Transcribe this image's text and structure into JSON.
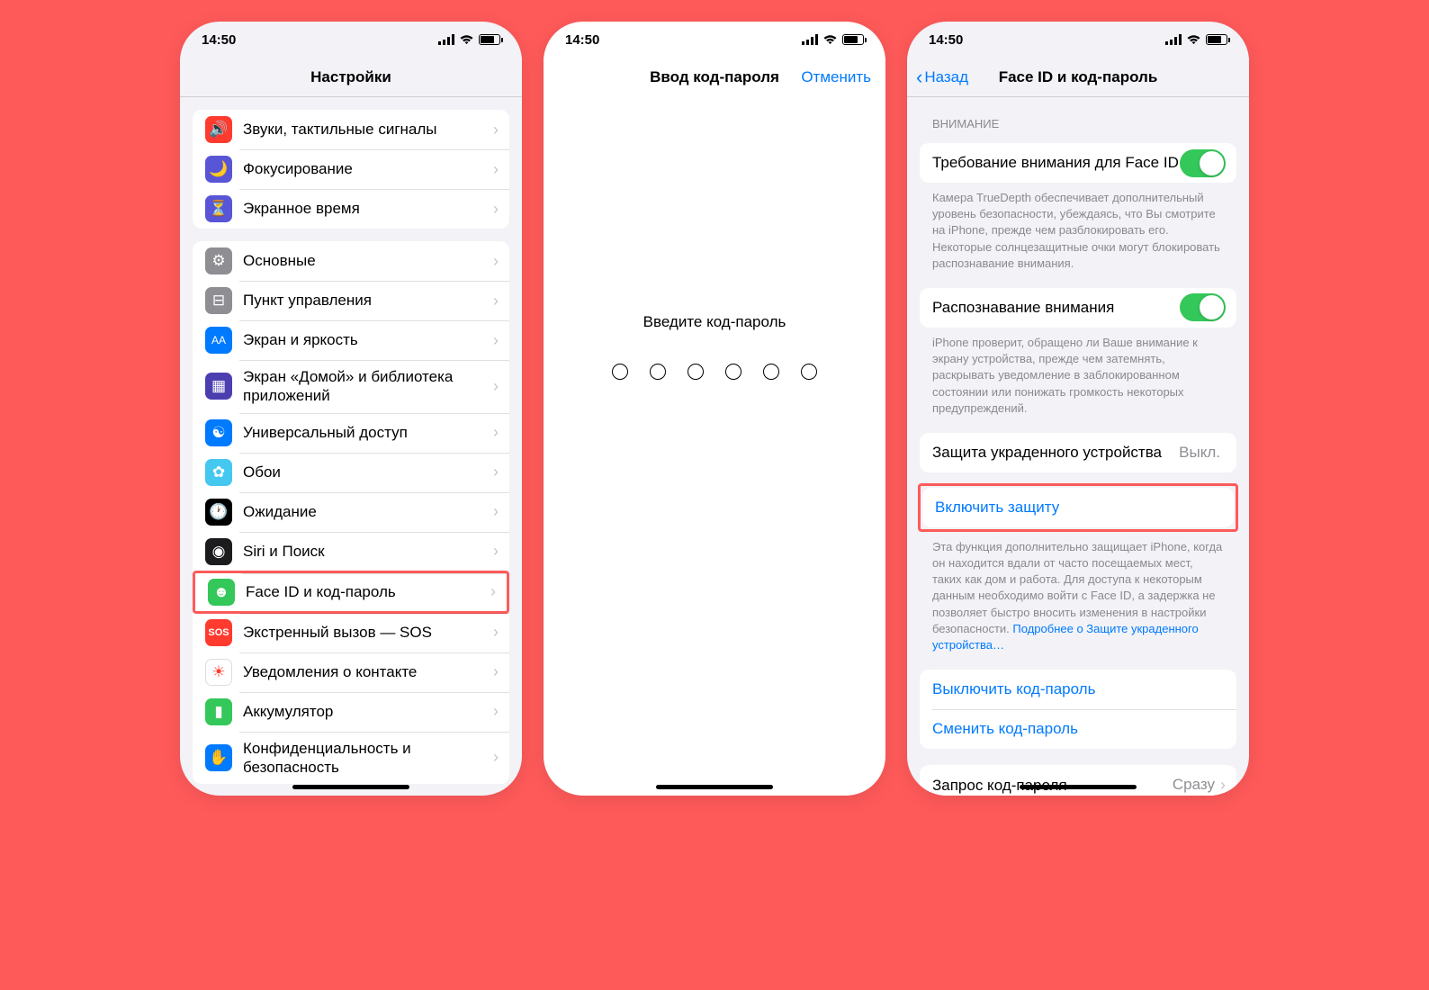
{
  "status": {
    "time": "14:50"
  },
  "phone1": {
    "title": "Настройки",
    "group1": [
      {
        "icon": "sound-icon",
        "bg": "#ff3b30",
        "label": "Звуки, тактильные сигналы"
      },
      {
        "icon": "moon-icon",
        "bg": "#5856d6",
        "label": "Фокусирование"
      },
      {
        "icon": "hourglass-icon",
        "bg": "#5856d6",
        "label": "Экранное время"
      }
    ],
    "group2": [
      {
        "icon": "gear-icon",
        "bg": "#8e8e93",
        "label": "Основные"
      },
      {
        "icon": "switches-icon",
        "bg": "#8e8e93",
        "label": "Пункт управления"
      },
      {
        "icon": "brightness-icon",
        "bg": "#007aff",
        "label": "Экран и яркость"
      },
      {
        "icon": "grid-icon",
        "bg": "#3a3a9e",
        "label": "Экран «Домой» и библиотека приложений"
      },
      {
        "icon": "accessibility-icon",
        "bg": "#007aff",
        "label": "Универсальный доступ"
      },
      {
        "icon": "flower-icon",
        "bg": "#45c8f0",
        "label": "Обои"
      },
      {
        "icon": "standby-icon",
        "bg": "#000000",
        "label": "Ожидание"
      },
      {
        "icon": "siri-icon",
        "bg": "#1c1c1e",
        "label": "Siri и Поиск"
      },
      {
        "icon": "faceid-icon",
        "bg": "#34c759",
        "label": "Face ID и код-пароль"
      },
      {
        "icon": "sos-icon",
        "bg": "#ff3b30",
        "label": "Экстренный вызов — SOS"
      },
      {
        "icon": "contact-icon",
        "bg": "#ffffff",
        "label": "Уведомления о контакте"
      },
      {
        "icon": "battery-icon",
        "bg": "#34c759",
        "label": "Аккумулятор"
      },
      {
        "icon": "hand-icon",
        "bg": "#007aff",
        "label": "Конфиденциальность и безопасность"
      }
    ]
  },
  "phone2": {
    "title": "Ввод код-пароля",
    "cancel": "Отменить",
    "prompt": "Введите код-пароль"
  },
  "phone3": {
    "back": "Назад",
    "title": "Face ID и код-пароль",
    "section_header": "ВНИМАНИЕ",
    "attention_row": "Требование внимания для Face ID",
    "attention_footer": "Камера TrueDepth обеспечивает дополнительный уровень безопасности, убеждаясь, что Вы смотрите на iPhone, прежде чем разблокировать его. Некоторые солнцезащитные очки могут блокировать распознавание внимания.",
    "aware_row": "Распознавание внимания",
    "aware_footer": "iPhone проверит, обращено ли Ваше внимание к экрану устройства, прежде чем затемнять, раскрывать уведомление в заблокированном состоянии или понижать громкость некоторых предупреждений.",
    "stolen_label": "Защита украденного устройства",
    "stolen_value": "Выкл.",
    "enable_protection": "Включить защиту",
    "stolen_footer": "Эта функция дополнительно защищает iPhone, когда он находится вдали от часто посещаемых мест, таких как дом и работа. Для доступа к некоторым данным необходимо войти с Face ID, а задержка не позволяет быстро вносить изменения в настройки безопасности. ",
    "stolen_footer_link": "Подробнее о Защите украденного устройства…",
    "disable_pass": "Выключить код-пароль",
    "change_pass": "Сменить код-пароль",
    "require_label": "Запрос код-пароля",
    "require_value": "Сразу"
  }
}
